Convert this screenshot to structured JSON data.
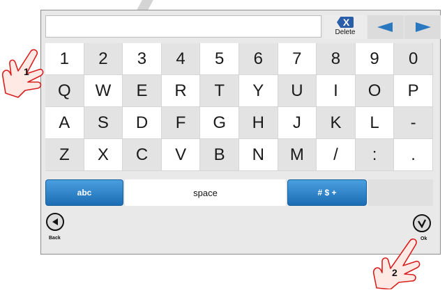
{
  "keyboard": {
    "delete_label": "Delete",
    "delete_glyph": "X",
    "row1": [
      "1",
      "2",
      "3",
      "4",
      "5",
      "6",
      "7",
      "8",
      "9",
      "0"
    ],
    "row2": [
      "Q",
      "W",
      "E",
      "R",
      "T",
      "Y",
      "U",
      "I",
      "O",
      "P"
    ],
    "row3": [
      "A",
      "S",
      "D",
      "F",
      "G",
      "H",
      "J",
      "K",
      "L",
      "-"
    ],
    "row4": [
      "Z",
      "X",
      "C",
      "V",
      "B",
      "N",
      "M",
      "/",
      ":",
      "."
    ],
    "abc_label": "abc",
    "space_label": "space",
    "symbols_label": "# $ +",
    "back_label": "Back",
    "ok_label": "Ok"
  },
  "callouts": {
    "step1": "1",
    "step2": "2"
  },
  "colors": {
    "accent_blue": "#2a78bf",
    "button_blue_top": "#4a9fe0",
    "button_blue_bottom": "#1c6db3"
  }
}
